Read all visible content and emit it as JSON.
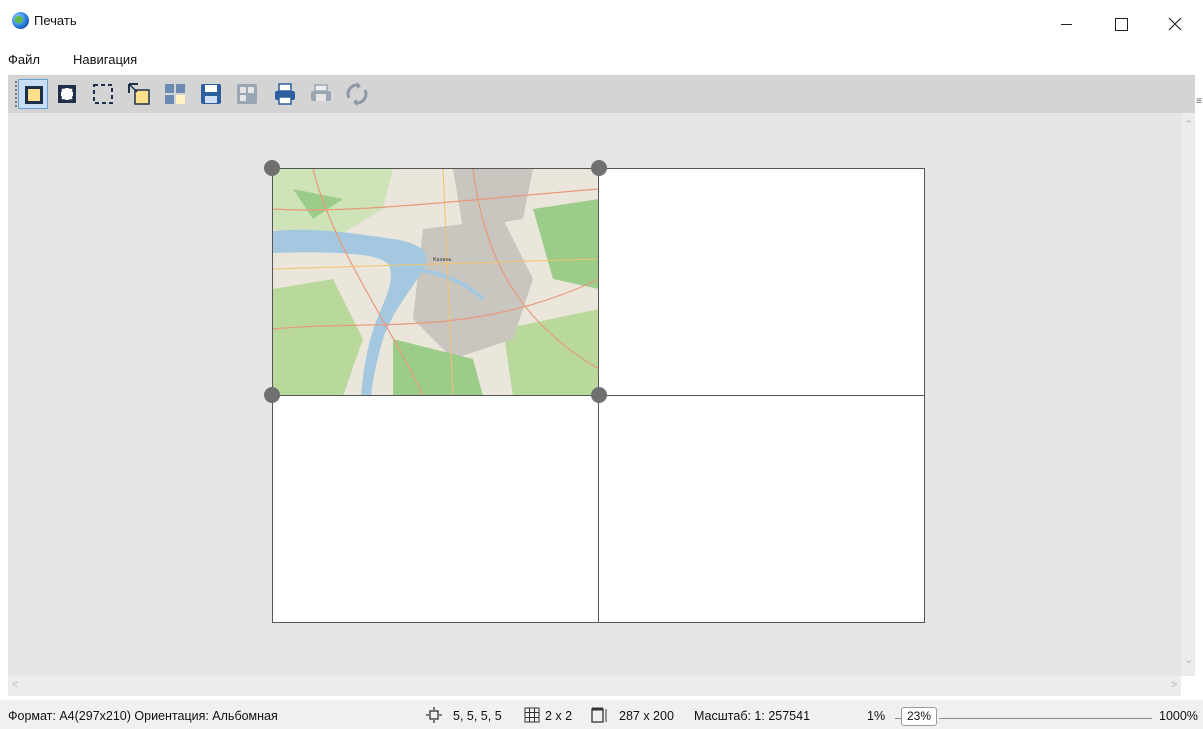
{
  "window": {
    "title": "Печать",
    "app_icon": "globe-icon",
    "controls": [
      "minimize-icon",
      "maximize-icon",
      "close-icon"
    ]
  },
  "menu": {
    "items": [
      {
        "label": "Файл"
      },
      {
        "label": "Навигация"
      }
    ]
  },
  "toolbar": {
    "buttons": [
      {
        "icon": "frame-page-icon",
        "active": true
      },
      {
        "icon": "frame-fit-icon",
        "active": false
      },
      {
        "icon": "frame-dashed-icon",
        "active": false
      },
      {
        "icon": "resize-corner-icon",
        "active": false
      },
      {
        "icon": "layout-grid-icon",
        "active": false
      },
      {
        "icon": "save-icon",
        "active": false
      },
      {
        "icon": "save-disabled-icon",
        "active": false
      },
      {
        "icon": "print-icon",
        "active": false
      },
      {
        "icon": "print-disabled-icon",
        "active": false
      },
      {
        "icon": "refresh-icon",
        "active": false
      }
    ]
  },
  "map": {
    "city_label": "Казань"
  },
  "status": {
    "format": "Формат: А4(297x210) Ориентация: Альбомная",
    "margins": "5, 5, 5, 5",
    "grid": "2 x 2",
    "size": "287 x 200",
    "scale": "Масштаб: 1: 257541",
    "zoom_min": "1%",
    "zoom_value": "23%",
    "zoom_max": "1000%",
    "zoom_fraction": 0.23
  },
  "colors": {
    "toolbar_bg": "#d4d4d4",
    "canvas_bg": "#e6e6e6",
    "active_button": "#c9def5",
    "map_water": "#a4c8e0",
    "map_land": "#eae6dc",
    "map_forest": "#9ccc8a",
    "map_urban": "#c9c5bf"
  }
}
